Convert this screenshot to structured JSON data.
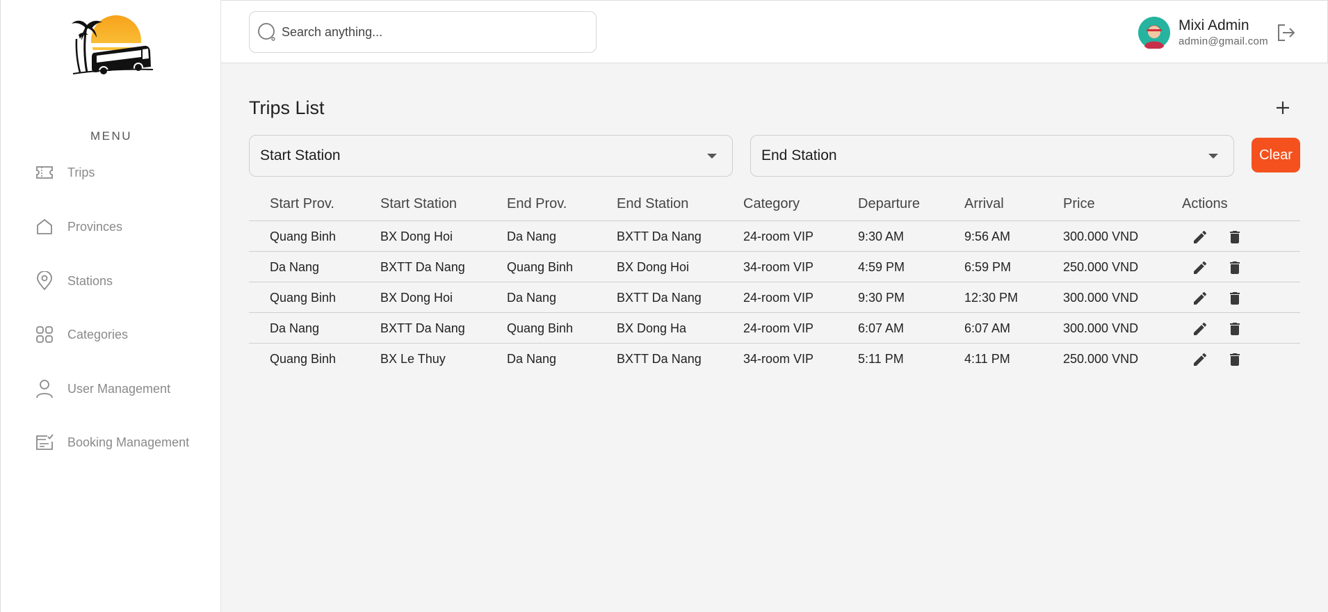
{
  "sidebar": {
    "menu_title": "MENU",
    "items": [
      {
        "label": "Trips",
        "icon": "ticket-icon"
      },
      {
        "label": "Provinces",
        "icon": "home-icon"
      },
      {
        "label": "Stations",
        "icon": "location-pin-icon"
      },
      {
        "label": "Categories",
        "icon": "grid-icon"
      },
      {
        "label": "User Management",
        "icon": "user-icon"
      },
      {
        "label": "Booking Management",
        "icon": "booking-checklist-icon"
      }
    ]
  },
  "header": {
    "search_placeholder": "Search anything...",
    "user_name": "Mixi Admin",
    "user_email": "admin@gmail.com"
  },
  "main": {
    "title": "Trips List",
    "filters": {
      "start_station": "Start Station",
      "end_station": "End Station",
      "clear_label": "Clear"
    },
    "table": {
      "columns": [
        "Start Prov.",
        "Start Station",
        "End Prov.",
        "End Station",
        "Category",
        "Departure",
        "Arrival",
        "Price",
        "Actions"
      ],
      "rows": [
        [
          "Quang Binh",
          "BX Dong Hoi",
          "Da Nang",
          "BXTT Da Nang",
          "24-room VIP",
          "9:30 AM",
          "9:56 AM",
          "300.000 VND"
        ],
        [
          "Da Nang",
          "BXTT Da Nang",
          "Quang Binh",
          "BX Dong Hoi",
          "34-room VIP",
          "4:59 PM",
          "6:59 PM",
          "250.000 VND"
        ],
        [
          "Quang Binh",
          "BX Dong Hoi",
          "Da Nang",
          "BXTT Da Nang",
          "24-room VIP",
          "9:30 PM",
          "12:30 PM",
          "300.000 VND"
        ],
        [
          "Da Nang",
          "BXTT Da Nang",
          "Quang Binh",
          "BX Dong Ha",
          "24-room VIP",
          "6:07 AM",
          "6:07 AM",
          "300.000 VND"
        ],
        [
          "Quang Binh",
          "BX Le Thuy",
          "Da Nang",
          "BXTT Da Nang",
          "34-room VIP",
          "5:11 PM",
          "4:11 PM",
          "250.000 VND"
        ]
      ]
    }
  },
  "colors": {
    "accent": "#f4511e",
    "icon_gray": "#3a3a3a",
    "nav_text": "#8a8a8a"
  }
}
